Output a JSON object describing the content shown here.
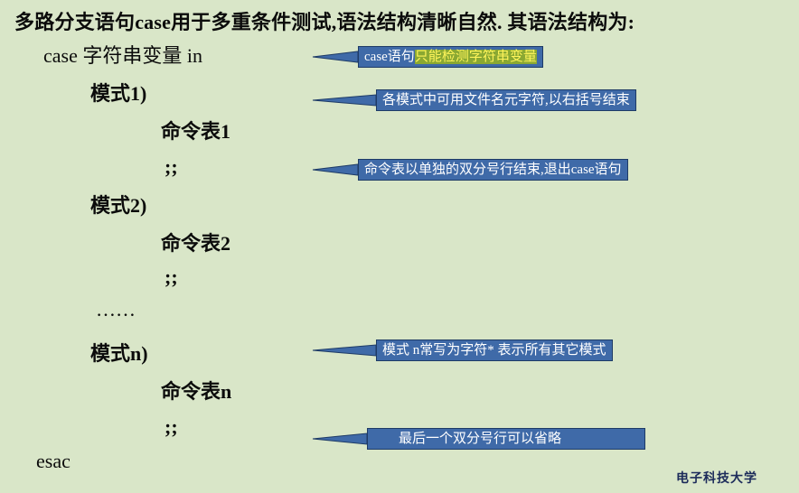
{
  "title": "多路分支语句case用于多重条件测试,语法结构清晰自然. 其语法结构为:",
  "code_lines": {
    "case_line": "case   字符串变量   in",
    "pattern1": "模式1)",
    "cmd1": "命令表1",
    "sep1": ";;",
    "pattern2": "模式2)",
    "cmd2": "命令表2",
    "sep2": ";;",
    "ellipsis": "……",
    "patternn": "模式n)",
    "cmdn": "命令表n",
    "sepn": ";;",
    "esac": "esac"
  },
  "callouts": {
    "c1_part1": "case语句",
    "c1_part2": "只能检测字符串变量",
    "c2": "各模式中可用文件名元字符,以右括号结束",
    "c3": "命令表以单独的双分号行结束,退出case语句",
    "c4": "模式 n常写为字符* 表示所有其它模式",
    "c5": "最后一个双分号行可以省略"
  },
  "footer": "电子科技大学",
  "colors": {
    "background": "#d9e6c8",
    "callout_fill": "#3f6aa8",
    "highlight_fill": "#8aa832",
    "highlight_text": "#fff45a",
    "footer_text": "#1c2b5a"
  }
}
